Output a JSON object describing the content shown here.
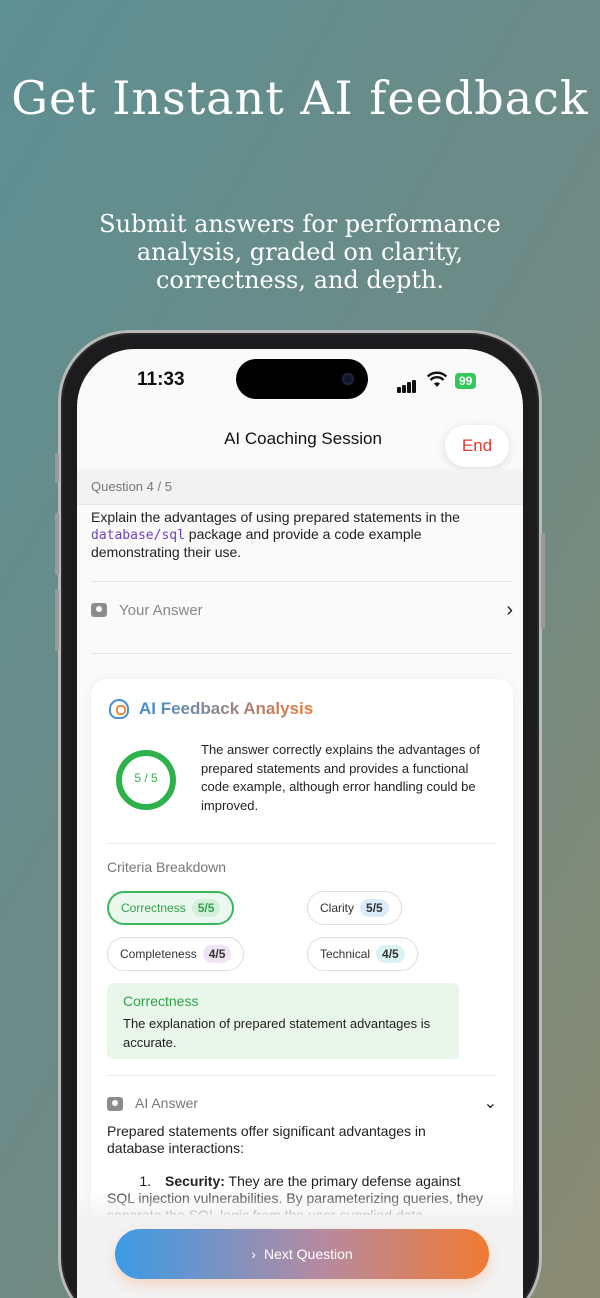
{
  "promo": {
    "headline": "Get Instant AI feedback",
    "subhead": "Submit answers for performance analysis, graded on clarity, correctness, and depth."
  },
  "status_bar": {
    "time": "11:33",
    "battery": "99"
  },
  "nav": {
    "title": "AI Coaching Session",
    "end_label": "End"
  },
  "question": {
    "counter": "Question 4 / 5",
    "text_before": "Explain the advantages of using prepared statements in the ",
    "code": "database/sql",
    "text_after": " package and provide a code example demonstrating their use."
  },
  "your_answer": {
    "label": "Your Answer"
  },
  "feedback": {
    "title": "AI Feedback Analysis",
    "score_label": "5 / 5",
    "score_fraction": 1.0,
    "summary": "The answer correctly explains the advantages of prepared statements and provides a functional code example, although error handling could be improved.",
    "criteria_title": "Criteria Breakdown",
    "criteria": [
      {
        "name": "Correctness",
        "score": "5/5",
        "color": "#d4f0da"
      },
      {
        "name": "Clarity",
        "score": "5/5",
        "color": "#dcebf8"
      },
      {
        "name": "Completeness",
        "score": "4/5",
        "color": "#f2e2f6"
      },
      {
        "name": "Technical",
        "score": "4/5",
        "color": "#dcf1f1"
      }
    ],
    "detail": {
      "title": "Correctness",
      "text": "The explanation of prepared statement advantages is accurate."
    }
  },
  "ai_answer": {
    "label": "AI Answer",
    "intro": "Prepared statements offer significant advantages in database interactions:",
    "item_number": "1.",
    "item_title": "Security:",
    "item_text": " They are the primary defense against SQL injection vulnerabilities. By parameterizing queries, they separate the SQL logic from the user-supplied data"
  },
  "footer": {
    "next_label": "Next Question"
  },
  "colors": {
    "accent_green": "#2fb24c",
    "end_red": "#e53935",
    "gradient_start": "#3b9be6",
    "gradient_end": "#f07a33"
  }
}
